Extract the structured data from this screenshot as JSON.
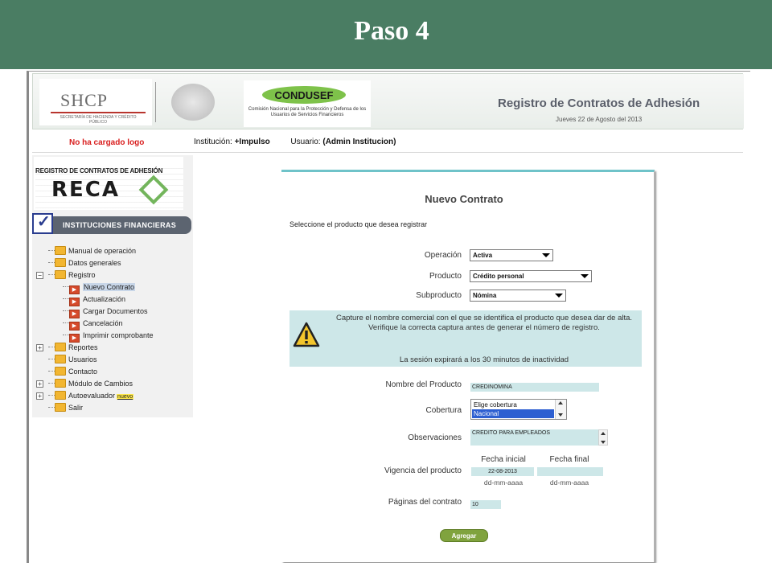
{
  "slide": {
    "title": "Paso 4"
  },
  "header": {
    "shcp_logo": "SHCP",
    "shcp_subtitle": "SECRETARÍA DE HACIENDA Y CRÉDITO PÚBLICO",
    "condusef_logo": "CONDUSEF",
    "condusef_subtitle": "Comisión Nacional para la Protección y Defensa de los Usuarios de Servicios Financieros",
    "app_title": "Registro de Contratos de Adhesión",
    "date": "Jueves 22 de Agosto del 2013"
  },
  "info_bar": {
    "logo_warning": "No ha cargado logo",
    "institution_label": "Institución:",
    "institution_value": "+Impulso",
    "user_label": "Usuario:",
    "user_value": "(Admin Institucion)"
  },
  "sidebar": {
    "reca_top": "REGISTRO DE CONTRATOS DE ADHESIÓN",
    "reca_logo": "RECA",
    "section_title": "INSTITUCIONES FINANCIERAS",
    "items": [
      {
        "label": "Manual de operación",
        "expander": ""
      },
      {
        "label": "Datos generales",
        "expander": ""
      },
      {
        "label": "Registro",
        "expander": "−"
      },
      {
        "label": "Nuevo Contrato",
        "child": true,
        "selected": true
      },
      {
        "label": "Actualización",
        "child": true
      },
      {
        "label": "Cargar Documentos",
        "child": true
      },
      {
        "label": "Cancelación",
        "child": true
      },
      {
        "label": "Imprimir comprobante",
        "child": true
      },
      {
        "label": "Reportes",
        "expander": "+"
      },
      {
        "label": "Usuarios",
        "expander": ""
      },
      {
        "label": "Contacto",
        "expander": ""
      },
      {
        "label": "Módulo de Cambios",
        "expander": "+"
      },
      {
        "label": "Autoevaluador",
        "expander": "+",
        "badge": "nuevo"
      },
      {
        "label": "Salir",
        "expander": ""
      }
    ]
  },
  "form": {
    "title": "Nuevo Contrato",
    "prompt": "Seleccione el producto que desea registrar",
    "operacion_label": "Operación",
    "operacion_value": "Activa",
    "producto_label": "Producto",
    "producto_value": "Crédito personal",
    "subproducto_label": "Subproducto",
    "subproducto_value": "Nómina",
    "warning_text": "Capture el nombre comercial con el que se identifica el producto que desea dar de alta. Verifique la correcta captura antes de generar el número de registro.",
    "session_text": "La sesión expirará a los 30 minutos de inactividad",
    "nombre_label": "Nombre del Producto",
    "nombre_value": "CREDINOMINA",
    "cobertura_label": "Cobertura",
    "cobertura_options": [
      "Elige cobertura",
      "Nacional"
    ],
    "observaciones_label": "Observaciones",
    "observaciones_value": "CREDITO PARA EMPLEADOS",
    "vigencia_label": "Vigencia del producto",
    "fecha_inicial_label": "Fecha inicial",
    "fecha_final_label": "Fecha final",
    "fecha_inicial_value": "22-08-2013",
    "fecha_final_value": "",
    "date_hint": "dd-mm-aaaa",
    "paginas_label": "Páginas del contrato",
    "paginas_value": "10",
    "submit_label": "Agregar"
  },
  "colors": {
    "slide_band": "#4a7d63",
    "panel_accent": "#6fc3c9",
    "field_bg": "#cde7e8",
    "submit": "#80a33e",
    "warning_red": "#d92020"
  }
}
